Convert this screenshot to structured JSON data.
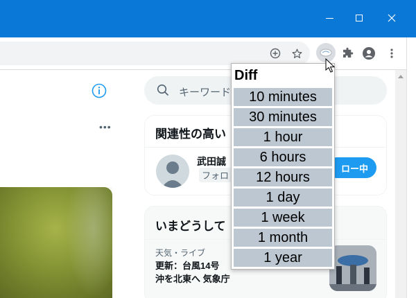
{
  "titlebar": {
    "color": "#0a78d7"
  },
  "toolbar": {
    "icons": [
      "add-circle-icon",
      "star-icon",
      "diff-extension-icon",
      "puzzle-icon",
      "profile-icon",
      "more-vert-icon"
    ]
  },
  "page": {
    "search": {
      "placeholder": "キーワード"
    },
    "card_recommend": {
      "title": "関連性の高い",
      "user_name": "武田誠",
      "follow_tag": "フォロ",
      "follow_button": "ロー中"
    },
    "card_trends": {
      "title": "いまどうして",
      "category": "天気・ライブ",
      "text": "更新：台風14号",
      "text2": "沖を北東へ 気象庁"
    }
  },
  "popup": {
    "title": "Diff",
    "items": [
      "10 minutes",
      "30 minutes",
      "1 hour",
      "6 hours",
      "12 hours",
      "1 day",
      "1 week",
      "1 month",
      "1 year"
    ],
    "item_color": "#bcc7d1"
  }
}
